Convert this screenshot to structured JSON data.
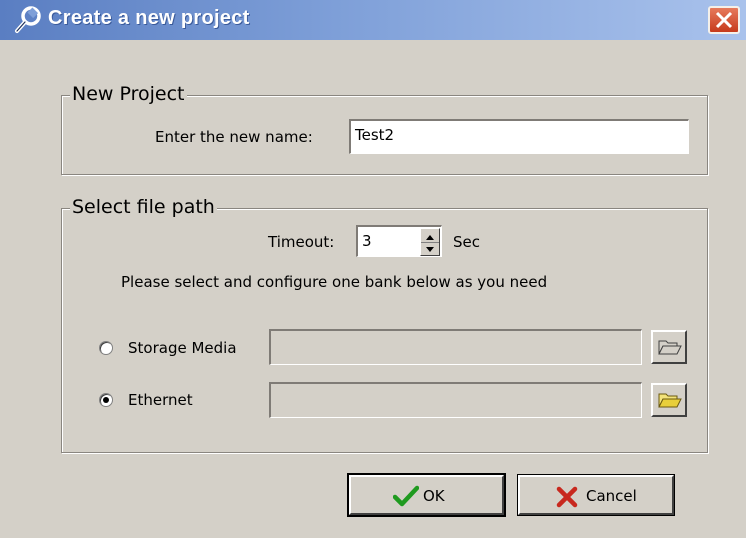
{
  "window": {
    "title": "Create a new project",
    "title_icon": "wrench-icon",
    "colors": {
      "titlebar_start": "#5a7ec2",
      "titlebar_end": "#a9c2ec",
      "close": "#d9542f",
      "face": "#d4d0c8"
    }
  },
  "new_project": {
    "legend": "New Project",
    "name_label": "Enter the new name:",
    "name_value": "Test2"
  },
  "file_path": {
    "legend": "Select file path",
    "timeout_label": "Timeout:",
    "timeout_value": "3",
    "timeout_unit": "Sec",
    "instruction": "Please select and configure one bank below as you need",
    "options": [
      {
        "label": "Storage Media",
        "selected": false,
        "path": "",
        "enabled": false
      },
      {
        "label": "Ethernet",
        "selected": true,
        "path": "",
        "enabled": true
      }
    ]
  },
  "buttons": {
    "ok_label": "OK",
    "cancel_label": "Cancel"
  }
}
